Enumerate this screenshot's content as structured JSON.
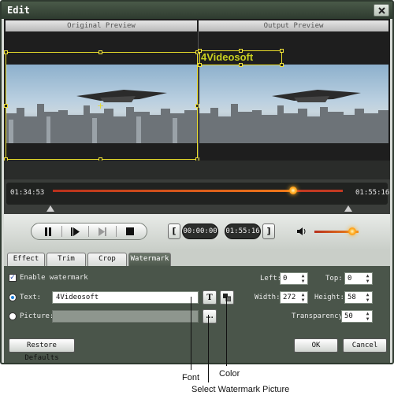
{
  "window": {
    "title": "Edit"
  },
  "preview": {
    "original_label": "Original Preview",
    "output_label": "Output Preview",
    "watermark_text": "4Videosoft"
  },
  "timeline": {
    "current_time": "01:34:53",
    "total_time": "01:55:16",
    "progress": 0.83
  },
  "controls": {
    "start_time": "00:00:00",
    "end_time": "01:55:16",
    "start_bracket": "[",
    "end_bracket": "]",
    "volume": 0.85
  },
  "tabs": [
    {
      "label": "Effect",
      "active": false
    },
    {
      "label": "Trim",
      "active": false
    },
    {
      "label": "Crop",
      "active": false
    },
    {
      "label": "Watermark",
      "active": true
    }
  ],
  "watermark": {
    "enable_label": "Enable watermark",
    "enabled": true,
    "text_label": "Text:",
    "text_value": "4Videosoft",
    "font_button": "T",
    "picture_label": "Picture:",
    "picture_value": "",
    "browse_label": "...",
    "left_label": "Left:",
    "left_value": "0",
    "top_label": "Top:",
    "top_value": "0",
    "width_label": "Width:",
    "width_value": "272",
    "height_label": "Height:",
    "height_value": "58",
    "transparency_label": "Transparency:",
    "transparency_value": "50"
  },
  "buttons": {
    "restore": "Restore Defaults",
    "ok": "OK",
    "cancel": "Cancel"
  },
  "annotations": {
    "font": "Font",
    "color": "Color",
    "select_picture": "Select Watermark Picture"
  }
}
